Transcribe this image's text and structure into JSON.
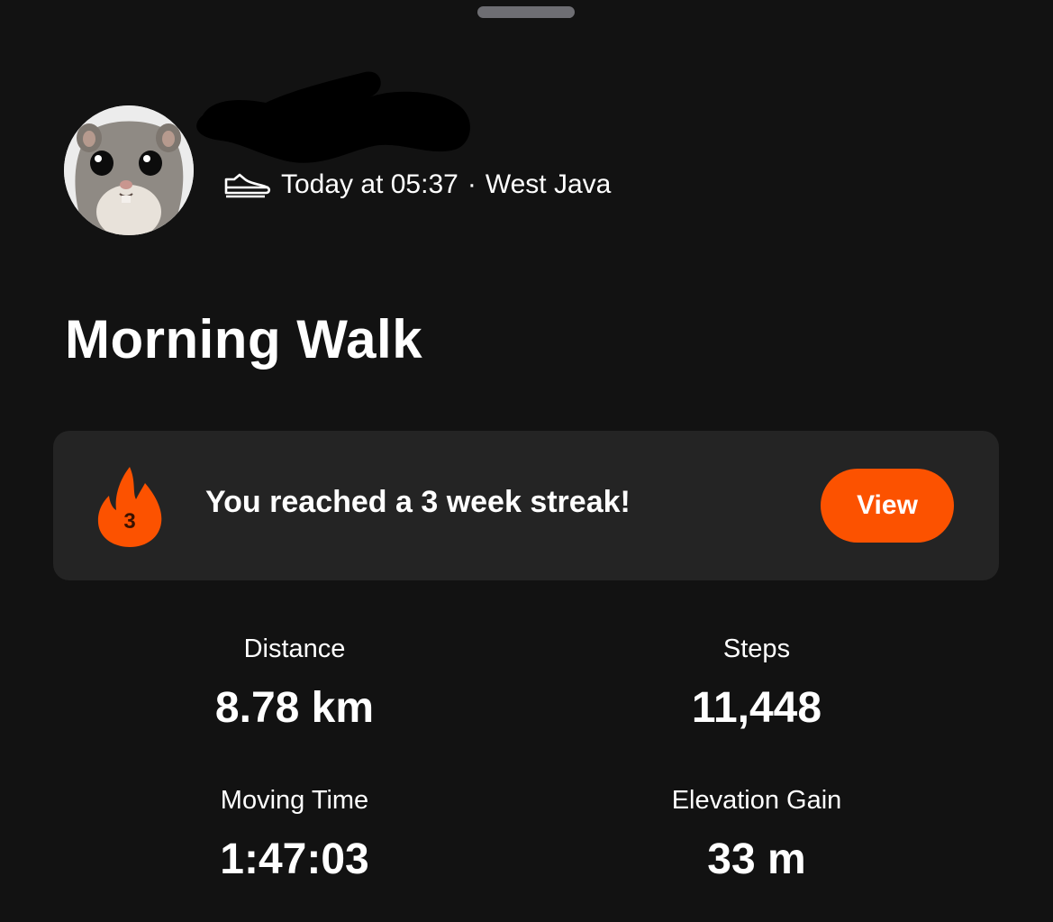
{
  "activity": {
    "meta": {
      "sport_icon": "shoe-icon",
      "time": "Today at 05:37",
      "separator": "·",
      "location": "West Java"
    },
    "title": "Morning Walk"
  },
  "streak": {
    "icon": "flame-icon",
    "count": "3",
    "message": "You reached a 3 week streak!",
    "button_label": "View"
  },
  "stats": [
    {
      "label": "Distance",
      "value": "8.78 km"
    },
    {
      "label": "Steps",
      "value": "11,448"
    },
    {
      "label": "Moving Time",
      "value": "1:47:03"
    },
    {
      "label": "Elevation Gain",
      "value": "33 m"
    }
  ],
  "colors": {
    "background": "#121212",
    "card": "#242424",
    "accent": "#fc5200",
    "text": "#ffffff"
  }
}
